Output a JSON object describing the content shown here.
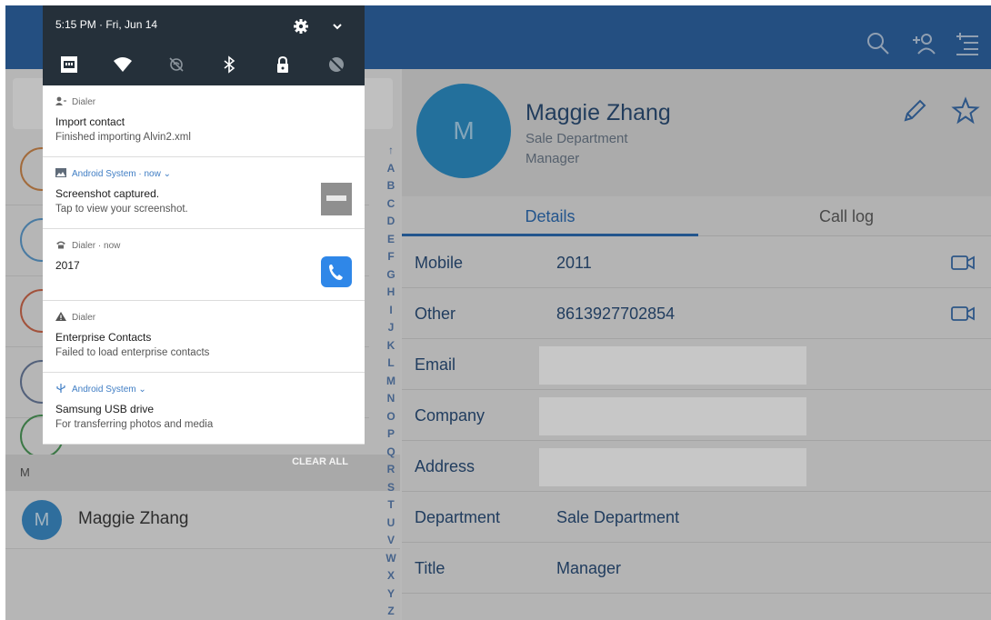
{
  "contacts": {
    "section_letter": "M",
    "visible_contact": {
      "initial": "M",
      "name": "Maggie Zhang"
    },
    "alphabet": [
      "↑",
      "A",
      "B",
      "C",
      "D",
      "E",
      "F",
      "G",
      "H",
      "I",
      "J",
      "K",
      "L",
      "M",
      "N",
      "O",
      "P",
      "Q",
      "R",
      "S",
      "T",
      "U",
      "V",
      "W",
      "X",
      "Y",
      "Z"
    ]
  },
  "detail": {
    "avatar_initial": "M",
    "name": "Maggie Zhang",
    "department": "Sale Department",
    "title": "Manager",
    "tabs": [
      {
        "label": "Details",
        "active": true
      },
      {
        "label": "Call log",
        "active": false
      }
    ],
    "fields": [
      {
        "label": "Mobile",
        "value": "2011",
        "video": true
      },
      {
        "label": "Other",
        "value": "8613927702854",
        "video": true
      },
      {
        "label": "Email",
        "value": "",
        "redacted": true
      },
      {
        "label": "Company",
        "value": "",
        "redacted": true
      },
      {
        "label": "Address",
        "value": "",
        "redacted": true
      },
      {
        "label": "Department",
        "value": "Sale Department"
      },
      {
        "label": "Title",
        "value": "Manager"
      }
    ]
  },
  "shade": {
    "time": "5:15 PM · Fri, Jun 14",
    "clear_all": "CLEAR ALL",
    "notifications": [
      {
        "app": "Dialer",
        "title": "Import contact",
        "text": "Finished importing Alvin2.xml",
        "icon": "dialer-contact-icon"
      },
      {
        "app": "Android System · now ⌄",
        "title": "Screenshot captured.",
        "text": "Tap to view your screenshot.",
        "icon": "image-icon"
      },
      {
        "app": "Dialer · now",
        "title": "2017",
        "text": "",
        "icon": "phone-icon"
      },
      {
        "app": "Dialer",
        "title": "Enterprise Contacts",
        "text": "Failed to load enterprise contacts",
        "icon": "warning-icon"
      },
      {
        "app": "Android System ⌄",
        "title": "Samsung USB drive",
        "text": "For transferring photos and media",
        "icon": "usb-icon"
      }
    ]
  },
  "colors": {
    "app_bar": "#2f66a6",
    "accent": "#2d6db5",
    "avatar": "#2e90c8",
    "shade_header": "#25303a"
  }
}
